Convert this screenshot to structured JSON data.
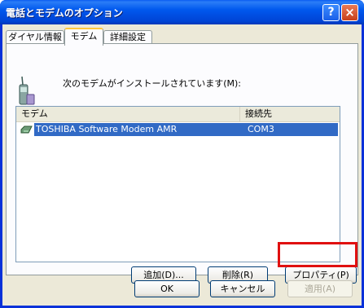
{
  "window": {
    "title": "電話とモデムのオプション",
    "help_glyph": "?",
    "close_glyph": "×"
  },
  "tabs": [
    {
      "label": "ダイヤル情報"
    },
    {
      "label": "モデム",
      "active": true
    },
    {
      "label": "詳細設定"
    }
  ],
  "main": {
    "instruction": "次のモデムがインストールされています(M):"
  },
  "list": {
    "columns": [
      "モデム",
      "接続先"
    ],
    "rows": [
      {
        "name": "TOSHIBA Software Modem AMR",
        "port": "COM3"
      }
    ]
  },
  "buttons": {
    "add": "追加(D)...",
    "remove": "削除(R)",
    "properties": "プロパティ(P)",
    "ok": "OK",
    "cancel": "キャンセル",
    "apply": "適用(A)"
  }
}
